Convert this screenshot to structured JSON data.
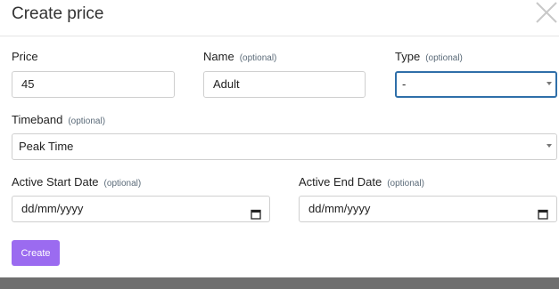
{
  "dialog": {
    "title": "Create price",
    "optional_tag": "(optional)",
    "fields": {
      "price": {
        "label": "Price",
        "value": "45"
      },
      "name": {
        "label": "Name",
        "value": "Adult"
      },
      "type": {
        "label": "Type",
        "value": "-"
      },
      "timeband": {
        "label": "Timeband",
        "value": "Peak Time"
      },
      "start_date": {
        "label": "Active Start Date",
        "value": "dd/mm/yyyy"
      },
      "end_date": {
        "label": "Active End Date",
        "value": "dd/mm/yyyy"
      }
    },
    "create_label": "Create"
  },
  "colors": {
    "accent": "#9b6bf0",
    "focus": "#2f6fa9",
    "overlay": "#6f6f6f"
  },
  "icons": [
    "close-icon",
    "chevron-down-icon",
    "calendar-icon"
  ]
}
